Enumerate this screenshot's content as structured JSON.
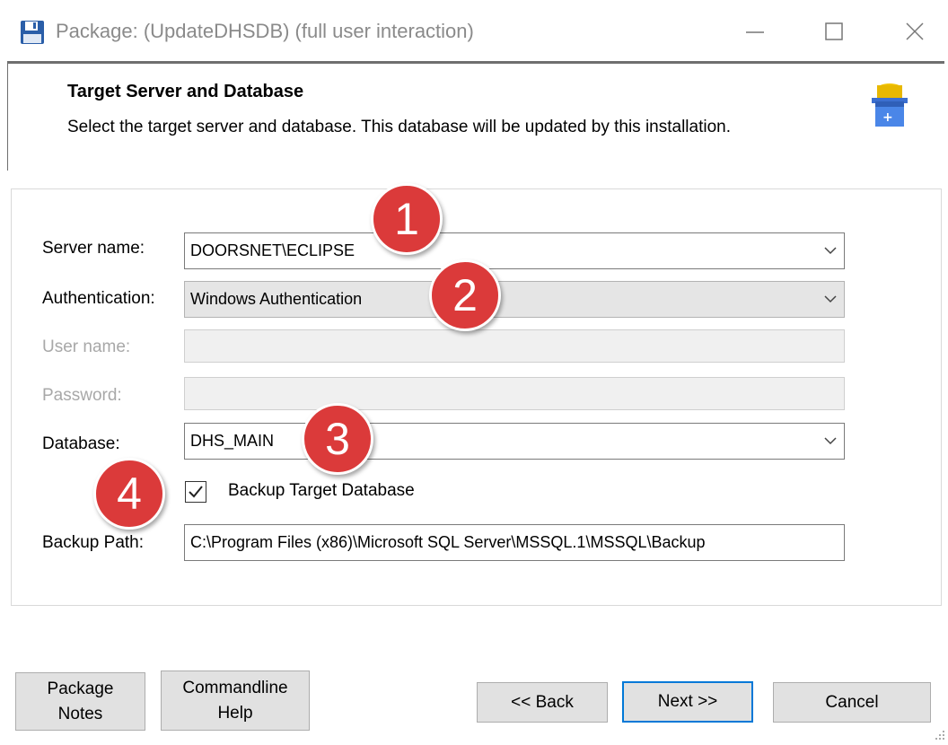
{
  "window": {
    "title": "Package: (UpdateDHSDB) (full user interaction)",
    "app_icon": "floppy-disk-icon"
  },
  "header": {
    "title": "Target Server and Database",
    "subtitle": "Select the target server and database. This database will be updated by this installation.",
    "icon": "database-install-icon"
  },
  "form": {
    "server_name": {
      "label": "Server name:",
      "value": "DOORSNET\\ECLIPSE"
    },
    "authentication": {
      "label": "Authentication:",
      "value": "Windows Authentication"
    },
    "user_name": {
      "label": "User name:",
      "value": ""
    },
    "password": {
      "label": "Password:",
      "value": ""
    },
    "database": {
      "label": "Database:",
      "value": "DHS_MAIN"
    },
    "backup_target": {
      "label": "Backup Target Database",
      "checked": true
    },
    "backup_path": {
      "label": "Backup Path:",
      "value": "C:\\Program Files (x86)\\Microsoft SQL Server\\MSSQL.1\\MSSQL\\Backup"
    }
  },
  "badges": [
    "1",
    "2",
    "3",
    "4"
  ],
  "buttons": {
    "package_notes": "Package\nNotes",
    "commandline_help": "Commandline\nHelp",
    "back": "<< Back",
    "next": "Next >>",
    "cancel": "Cancel"
  },
  "colors": {
    "badge": "#db3a3a",
    "default_button_border": "#0078d7"
  }
}
